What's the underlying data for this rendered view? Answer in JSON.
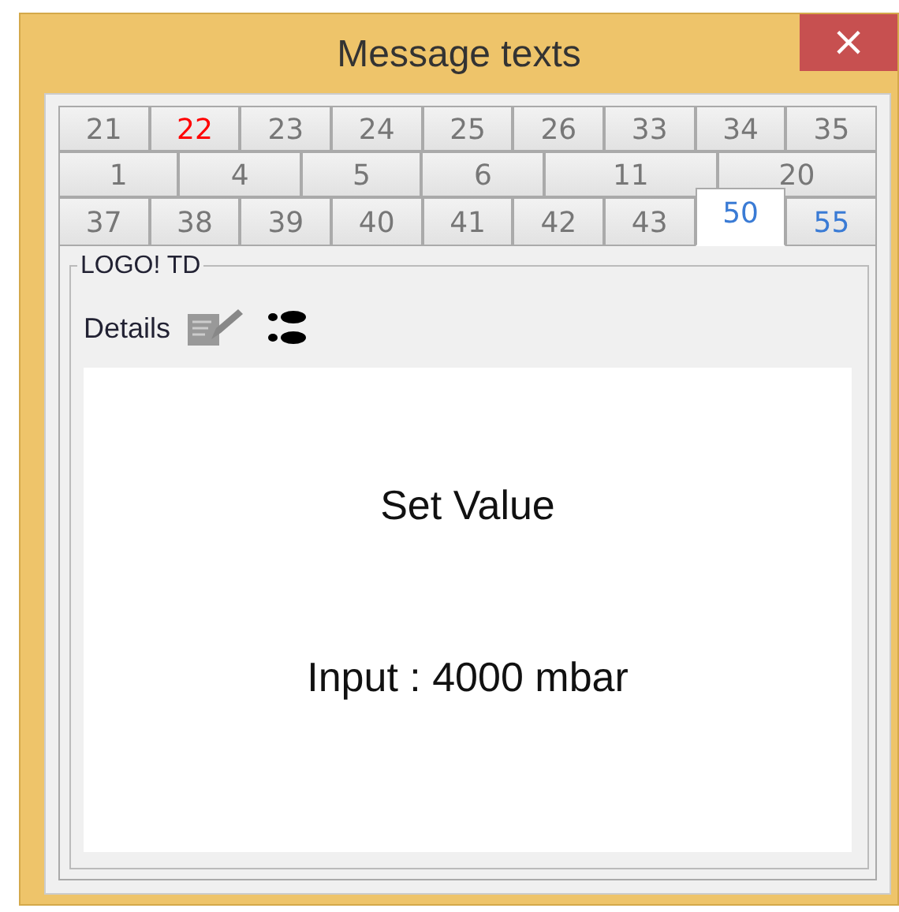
{
  "window": {
    "title": "Message texts",
    "close": "×"
  },
  "tab_rows": [
    [
      {
        "label": "21",
        "selected": false
      },
      {
        "label": "22",
        "selected": false,
        "color": "#ff0000"
      },
      {
        "label": "23",
        "selected": false
      },
      {
        "label": "24",
        "selected": false
      },
      {
        "label": "25",
        "selected": false
      },
      {
        "label": "26",
        "selected": false
      },
      {
        "label": "33",
        "selected": false
      },
      {
        "label": "34",
        "selected": false
      },
      {
        "label": "35",
        "selected": false
      }
    ],
    [
      {
        "label": "1",
        "selected": false
      },
      {
        "label": "4",
        "selected": false
      },
      {
        "label": "5",
        "selected": false
      },
      {
        "label": "6",
        "selected": false
      },
      {
        "label": "11",
        "selected": false
      },
      {
        "label": "20",
        "selected": false
      }
    ],
    [
      {
        "label": "37",
        "selected": false
      },
      {
        "label": "38",
        "selected": false
      },
      {
        "label": "39",
        "selected": false
      },
      {
        "label": "40",
        "selected": false
      },
      {
        "label": "41",
        "selected": false
      },
      {
        "label": "42",
        "selected": false
      },
      {
        "label": "43",
        "selected": false
      },
      {
        "label": "50",
        "selected": true,
        "color": "#3a7bd5"
      },
      {
        "label": "55",
        "selected": false,
        "color": "#3a7bd5"
      }
    ]
  ],
  "group": {
    "title": "LOGO! TD",
    "details_label": "Details"
  },
  "display": {
    "lines": [
      "Set Value",
      "Input : 4000 mbar"
    ]
  }
}
